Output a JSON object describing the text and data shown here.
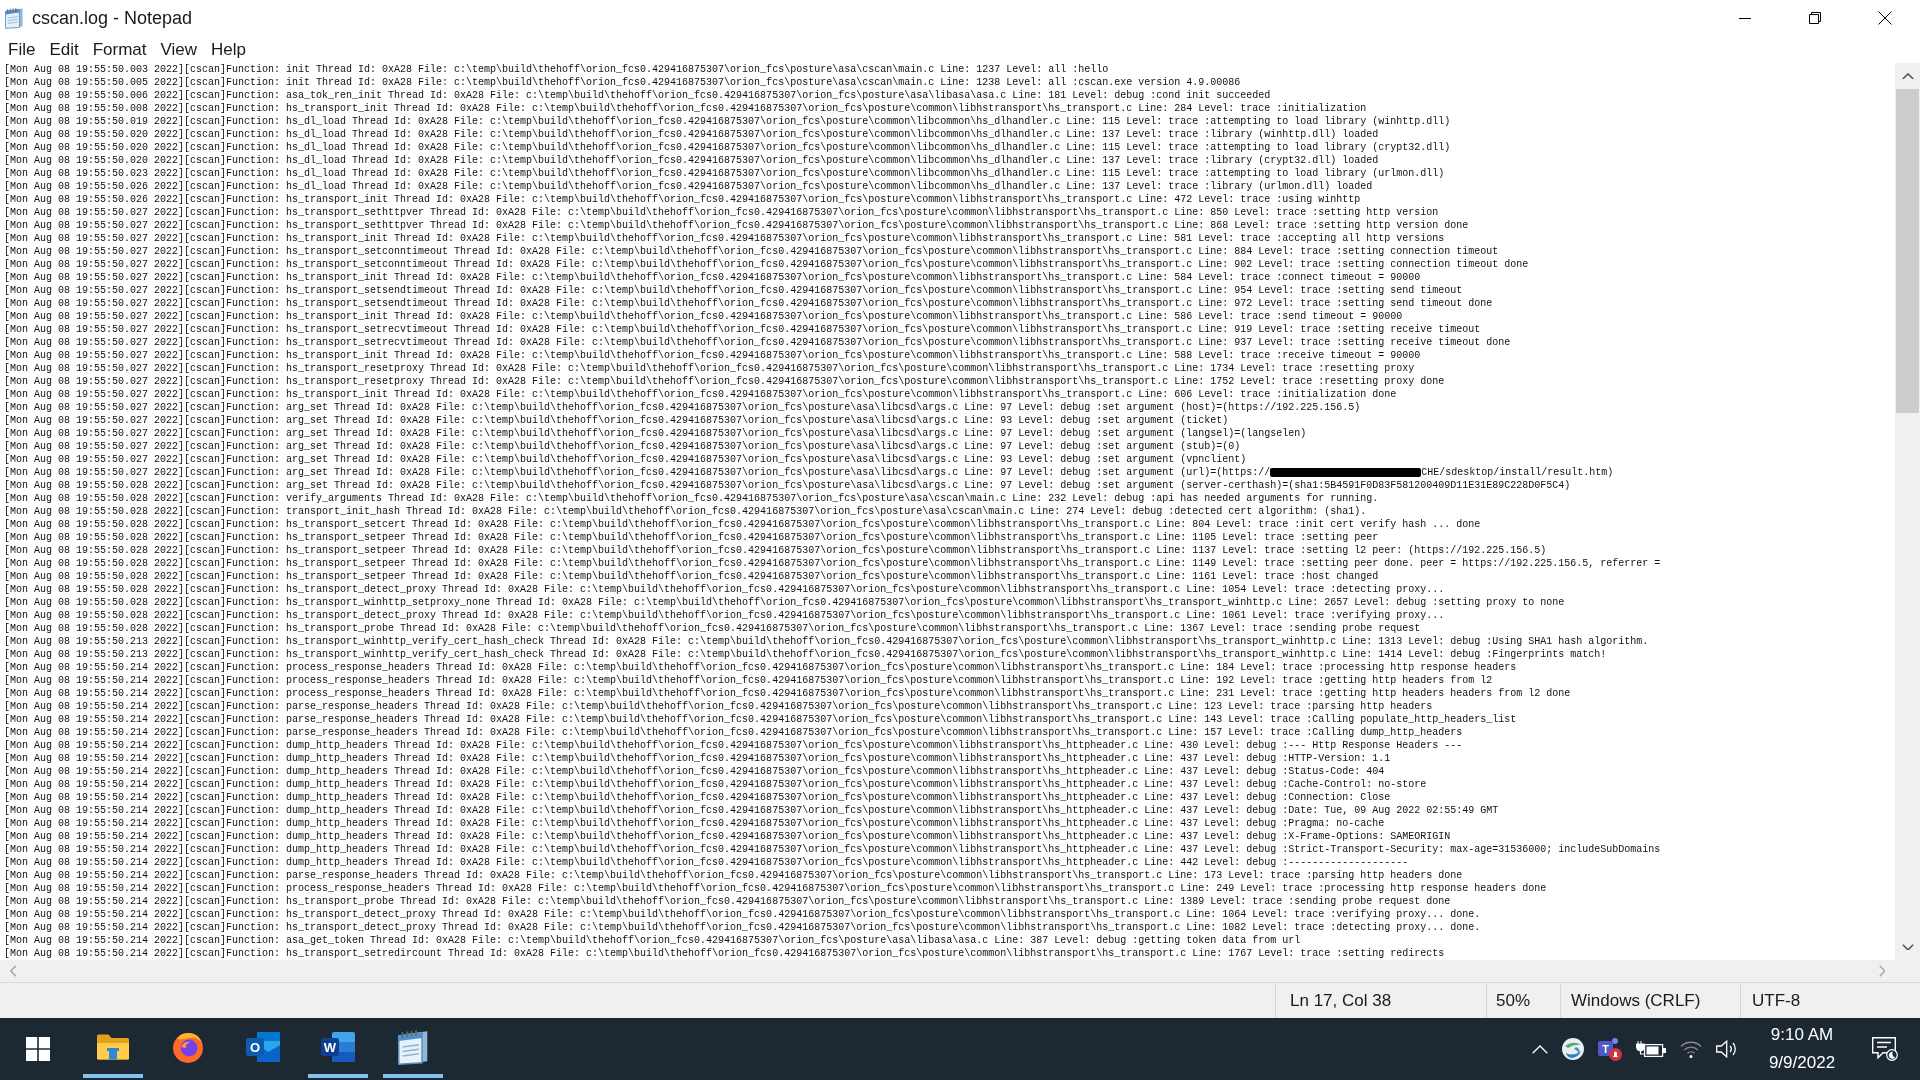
{
  "window": {
    "title": "cscan.log - Notepad"
  },
  "menu": [
    "File",
    "Edit",
    "Format",
    "View",
    "Help"
  ],
  "editor": {
    "lines": [
      {
        "kind": "plain",
        "text": "[Mon Aug 08 19:55:50.003 2022][cscan]Function: init Thread Id: 0xA28 File: c:\\temp\\build\\thehoff\\orion_fcs0.429416875307\\orion_fcs\\posture\\asa\\cscan\\main.c Line: 1237 Level: all :hello"
      },
      {
        "kind": "plain",
        "text": "[Mon Aug 08 19:55:50.005 2022][cscan]Function: init Thread Id: 0xA28 File: c:\\temp\\build\\thehoff\\orion_fcs0.429416875307\\orion_fcs\\posture\\asa\\cscan\\main.c Line: 1238 Level: all :cscan.exe version 4.9.00086"
      },
      {
        "kind": "plain",
        "text": "[Mon Aug 08 19:55:50.006 2022][cscan]Function: asa_tok_ren_init Thread Id: 0xA28 File: c:\\temp\\build\\thehoff\\orion_fcs0.429416875307\\orion_fcs\\posture\\asa\\libasa\\asa.c Line: 181 Level: debug :cond init succeeded"
      },
      {
        "kind": "plain",
        "text": "[Mon Aug 08 19:55:50.008 2022][cscan]Function: hs_transport_init Thread Id: 0xA28 File: c:\\temp\\build\\thehoff\\orion_fcs0.429416875307\\orion_fcs\\posture\\common\\libhstransport\\hs_transport.c Line: 284 Level: trace :initialization"
      },
      {
        "kind": "plain",
        "text": "[Mon Aug 08 19:55:50.019 2022][cscan]Function: hs_dl_load Thread Id: 0xA28 File: c:\\temp\\build\\thehoff\\orion_fcs0.429416875307\\orion_fcs\\posture\\common\\libcommon\\hs_dlhandler.c Line: 115 Level: trace :attempting to load library (winhttp.dll)"
      },
      {
        "kind": "plain",
        "text": "[Mon Aug 08 19:55:50.020 2022][cscan]Function: hs_dl_load Thread Id: 0xA28 File: c:\\temp\\build\\thehoff\\orion_fcs0.429416875307\\orion_fcs\\posture\\common\\libcommon\\hs_dlhandler.c Line: 137 Level: trace :library (winhttp.dll) loaded"
      },
      {
        "kind": "plain",
        "text": "[Mon Aug 08 19:55:50.020 2022][cscan]Function: hs_dl_load Thread Id: 0xA28 File: c:\\temp\\build\\thehoff\\orion_fcs0.429416875307\\orion_fcs\\posture\\common\\libcommon\\hs_dlhandler.c Line: 115 Level: trace :attempting to load library (crypt32.dll)"
      },
      {
        "kind": "plain",
        "text": "[Mon Aug 08 19:55:50.020 2022][cscan]Function: hs_dl_load Thread Id: 0xA28 File: c:\\temp\\build\\thehoff\\orion_fcs0.429416875307\\orion_fcs\\posture\\common\\libcommon\\hs_dlhandler.c Line: 137 Level: trace :library (crypt32.dll) loaded"
      },
      {
        "kind": "plain",
        "text": "[Mon Aug 08 19:55:50.023 2022][cscan]Function: hs_dl_load Thread Id: 0xA28 File: c:\\temp\\build\\thehoff\\orion_fcs0.429416875307\\orion_fcs\\posture\\common\\libcommon\\hs_dlhandler.c Line: 115 Level: trace :attempting to load library (urlmon.dll)"
      },
      {
        "kind": "plain",
        "text": "[Mon Aug 08 19:55:50.026 2022][cscan]Function: hs_dl_load Thread Id: 0xA28 File: c:\\temp\\build\\thehoff\\orion_fcs0.429416875307\\orion_fcs\\posture\\common\\libcommon\\hs_dlhandler.c Line: 137 Level: trace :library (urlmon.dll) loaded"
      },
      {
        "kind": "plain",
        "text": "[Mon Aug 08 19:55:50.026 2022][cscan]Function: hs_transport_init Thread Id: 0xA28 File: c:\\temp\\build\\thehoff\\orion_fcs0.429416875307\\orion_fcs\\posture\\common\\libhstransport\\hs_transport.c Line: 472 Level: trace :using winhttp"
      },
      {
        "kind": "plain",
        "text": "[Mon Aug 08 19:55:50.027 2022][cscan]Function: hs_transport_sethttpver Thread Id: 0xA28 File: c:\\temp\\build\\thehoff\\orion_fcs0.429416875307\\orion_fcs\\posture\\common\\libhstransport\\hs_transport.c Line: 850 Level: trace :setting http version"
      },
      {
        "kind": "plain",
        "text": "[Mon Aug 08 19:55:50.027 2022][cscan]Function: hs_transport_sethttpver Thread Id: 0xA28 File: c:\\temp\\build\\thehoff\\orion_fcs0.429416875307\\orion_fcs\\posture\\common\\libhstransport\\hs_transport.c Line: 868 Level: trace :setting http version done"
      },
      {
        "kind": "plain",
        "text": "[Mon Aug 08 19:55:50.027 2022][cscan]Function: hs_transport_init Thread Id: 0xA28 File: c:\\temp\\build\\thehoff\\orion_fcs0.429416875307\\orion_fcs\\posture\\common\\libhstransport\\hs_transport.c Line: 581 Level: trace :accepting all http versions"
      },
      {
        "kind": "plain",
        "text": "[Mon Aug 08 19:55:50.027 2022][cscan]Function: hs_transport_setconntimeout Thread Id: 0xA28 File: c:\\temp\\build\\thehoff\\orion_fcs0.429416875307\\orion_fcs\\posture\\common\\libhstransport\\hs_transport.c Line: 884 Level: trace :setting connection timeout"
      },
      {
        "kind": "plain",
        "text": "[Mon Aug 08 19:55:50.027 2022][cscan]Function: hs_transport_setconntimeout Thread Id: 0xA28 File: c:\\temp\\build\\thehoff\\orion_fcs0.429416875307\\orion_fcs\\posture\\common\\libhstransport\\hs_transport.c Line: 902 Level: trace :setting connection timeout done"
      },
      {
        "kind": "plain",
        "text": "[Mon Aug 08 19:55:50.027 2022][cscan]Function: hs_transport_init Thread Id: 0xA28 File: c:\\temp\\build\\thehoff\\orion_fcs0.429416875307\\orion_fcs\\posture\\common\\libhstransport\\hs_transport.c Line: 584 Level: trace :connect timeout = 90000"
      },
      {
        "kind": "plain",
        "text": "[Mon Aug 08 19:55:50.027 2022][cscan]Function: hs_transport_setsendtimeout Thread Id: 0xA28 File: c:\\temp\\build\\thehoff\\orion_fcs0.429416875307\\orion_fcs\\posture\\common\\libhstransport\\hs_transport.c Line: 954 Level: trace :setting send timeout"
      },
      {
        "kind": "plain",
        "text": "[Mon Aug 08 19:55:50.027 2022][cscan]Function: hs_transport_setsendtimeout Thread Id: 0xA28 File: c:\\temp\\build\\thehoff\\orion_fcs0.429416875307\\orion_fcs\\posture\\common\\libhstransport\\hs_transport.c Line: 972 Level: trace :setting send timeout done"
      },
      {
        "kind": "plain",
        "text": "[Mon Aug 08 19:55:50.027 2022][cscan]Function: hs_transport_init Thread Id: 0xA28 File: c:\\temp\\build\\thehoff\\orion_fcs0.429416875307\\orion_fcs\\posture\\common\\libhstransport\\hs_transport.c Line: 586 Level: trace :send timeout = 90000"
      },
      {
        "kind": "plain",
        "text": "[Mon Aug 08 19:55:50.027 2022][cscan]Function: hs_transport_setrecvtimeout Thread Id: 0xA28 File: c:\\temp\\build\\thehoff\\orion_fcs0.429416875307\\orion_fcs\\posture\\common\\libhstransport\\hs_transport.c Line: 919 Level: trace :setting receive timeout"
      },
      {
        "kind": "plain",
        "text": "[Mon Aug 08 19:55:50.027 2022][cscan]Function: hs_transport_setrecvtimeout Thread Id: 0xA28 File: c:\\temp\\build\\thehoff\\orion_fcs0.429416875307\\orion_fcs\\posture\\common\\libhstransport\\hs_transport.c Line: 937 Level: trace :setting receive timeout done"
      },
      {
        "kind": "plain",
        "text": "[Mon Aug 08 19:55:50.027 2022][cscan]Function: hs_transport_init Thread Id: 0xA28 File: c:\\temp\\build\\thehoff\\orion_fcs0.429416875307\\orion_fcs\\posture\\common\\libhstransport\\hs_transport.c Line: 588 Level: trace :receive timeout = 90000"
      },
      {
        "kind": "plain",
        "text": "[Mon Aug 08 19:55:50.027 2022][cscan]Function: hs_transport_resetproxy Thread Id: 0xA28 File: c:\\temp\\build\\thehoff\\orion_fcs0.429416875307\\orion_fcs\\posture\\common\\libhstransport\\hs_transport.c Line: 1734 Level: trace :resetting proxy"
      },
      {
        "kind": "plain",
        "text": "[Mon Aug 08 19:55:50.027 2022][cscan]Function: hs_transport_resetproxy Thread Id: 0xA28 File: c:\\temp\\build\\thehoff\\orion_fcs0.429416875307\\orion_fcs\\posture\\common\\libhstransport\\hs_transport.c Line: 1752 Level: trace :resetting proxy done"
      },
      {
        "kind": "plain",
        "text": "[Mon Aug 08 19:55:50.027 2022][cscan]Function: hs_transport_init Thread Id: 0xA28 File: c:\\temp\\build\\thehoff\\orion_fcs0.429416875307\\orion_fcs\\posture\\common\\libhstransport\\hs_transport.c Line: 606 Level: trace :initialization done"
      },
      {
        "kind": "plain",
        "text": "[Mon Aug 08 19:55:50.027 2022][cscan]Function: arg_set Thread Id: 0xA28 File: c:\\temp\\build\\thehoff\\orion_fcs0.429416875307\\orion_fcs\\posture\\asa\\libcsd\\args.c Line: 97 Level: debug :set argument (host)=(https://192.225.156.5)"
      },
      {
        "kind": "plain",
        "text": "[Mon Aug 08 19:55:50.027 2022][cscan]Function: arg_set Thread Id: 0xA28 File: c:\\temp\\build\\thehoff\\orion_fcs0.429416875307\\orion_fcs\\posture\\asa\\libcsd\\args.c Line: 93 Level: debug :set argument (ticket)"
      },
      {
        "kind": "plain",
        "text": "[Mon Aug 08 19:55:50.027 2022][cscan]Function: arg_set Thread Id: 0xA28 File: c:\\temp\\build\\thehoff\\orion_fcs0.429416875307\\orion_fcs\\posture\\asa\\libcsd\\args.c Line: 97 Level: debug :set argument (langsel)=(langselen)"
      },
      {
        "kind": "plain",
        "text": "[Mon Aug 08 19:55:50.027 2022][cscan]Function: arg_set Thread Id: 0xA28 File: c:\\temp\\build\\thehoff\\orion_fcs0.429416875307\\orion_fcs\\posture\\asa\\libcsd\\args.c Line: 97 Level: debug :set argument (stub)=(0)"
      },
      {
        "kind": "plain",
        "text": "[Mon Aug 08 19:55:50.027 2022][cscan]Function: arg_set Thread Id: 0xA28 File: c:\\temp\\build\\thehoff\\orion_fcs0.429416875307\\orion_fcs\\posture\\asa\\libcsd\\args.c Line: 93 Level: debug :set argument (vpnclient)"
      },
      {
        "kind": "redacted",
        "before": "[Mon Aug 08 19:55:50.027 2022][cscan]Function: arg_set Thread Id: 0xA28 File: c:\\temp\\build\\thehoff\\orion_fcs0.429416875307\\orion_fcs\\posture\\asa\\libcsd\\args.c Line: 97 Level: debug :set argument (url)=(https://",
        "after": "CHE/sdesktop/install/result.htm)"
      },
      {
        "kind": "plain",
        "text": "[Mon Aug 08 19:55:50.028 2022][cscan]Function: arg_set Thread Id: 0xA28 File: c:\\temp\\build\\thehoff\\orion_fcs0.429416875307\\orion_fcs\\posture\\asa\\libcsd\\args.c Line: 97 Level: debug :set argument (server-certhash)=(sha1:5B4591F0D83F581200409D11E31E89C228D0F5C4)"
      },
      {
        "kind": "plain",
        "text": "[Mon Aug 08 19:55:50.028 2022][cscan]Function: verify_arguments Thread Id: 0xA28 File: c:\\temp\\build\\thehoff\\orion_fcs0.429416875307\\orion_fcs\\posture\\asa\\cscan\\main.c Line: 232 Level: debug :api has needed arguments for running."
      },
      {
        "kind": "plain",
        "text": "[Mon Aug 08 19:55:50.028 2022][cscan]Function: transport_init_hash Thread Id: 0xA28 File: c:\\temp\\build\\thehoff\\orion_fcs0.429416875307\\orion_fcs\\posture\\asa\\cscan\\main.c Line: 274 Level: debug :detected cert algorithm: (sha1)."
      },
      {
        "kind": "plain",
        "text": "[Mon Aug 08 19:55:50.028 2022][cscan]Function: hs_transport_setcert Thread Id: 0xA28 File: c:\\temp\\build\\thehoff\\orion_fcs0.429416875307\\orion_fcs\\posture\\common\\libhstransport\\hs_transport.c Line: 804 Level: trace :init cert verify hash ... done"
      },
      {
        "kind": "plain",
        "text": "[Mon Aug 08 19:55:50.028 2022][cscan]Function: hs_transport_setpeer Thread Id: 0xA28 File: c:\\temp\\build\\thehoff\\orion_fcs0.429416875307\\orion_fcs\\posture\\common\\libhstransport\\hs_transport.c Line: 1105 Level: trace :setting peer"
      },
      {
        "kind": "plain",
        "text": "[Mon Aug 08 19:55:50.028 2022][cscan]Function: hs_transport_setpeer Thread Id: 0xA28 File: c:\\temp\\build\\thehoff\\orion_fcs0.429416875307\\orion_fcs\\posture\\common\\libhstransport\\hs_transport.c Line: 1137 Level: trace :setting l2 peer: (https://192.225.156.5)"
      },
      {
        "kind": "plain",
        "text": "[Mon Aug 08 19:55:50.028 2022][cscan]Function: hs_transport_setpeer Thread Id: 0xA28 File: c:\\temp\\build\\thehoff\\orion_fcs0.429416875307\\orion_fcs\\posture\\common\\libhstransport\\hs_transport.c Line: 1149 Level: trace :setting peer done. peer = https://192.225.156.5, referrer ="
      },
      {
        "kind": "plain",
        "text": "[Mon Aug 08 19:55:50.028 2022][cscan]Function: hs_transport_setpeer Thread Id: 0xA28 File: c:\\temp\\build\\thehoff\\orion_fcs0.429416875307\\orion_fcs\\posture\\common\\libhstransport\\hs_transport.c Line: 1161 Level: trace :host changed"
      },
      {
        "kind": "plain",
        "text": "[Mon Aug 08 19:55:50.028 2022][cscan]Function: hs_transport_detect_proxy Thread Id: 0xA28 File: c:\\temp\\build\\thehoff\\orion_fcs0.429416875307\\orion_fcs\\posture\\common\\libhstransport\\hs_transport.c Line: 1054 Level: trace :detecting proxy..."
      },
      {
        "kind": "plain",
        "text": "[Mon Aug 08 19:55:50.028 2022][cscan]Function: hs_transport_winhttp_setproxy_none Thread Id: 0xA28 File: c:\\temp\\build\\thehoff\\orion_fcs0.429416875307\\orion_fcs\\posture\\common\\libhstransport\\hs_transport_winhttp.c Line: 2657 Level: debug :setting proxy to none"
      },
      {
        "kind": "plain",
        "text": "[Mon Aug 08 19:55:50.028 2022][cscan]Function: hs_transport_detect_proxy Thread Id: 0xA28 File: c:\\temp\\build\\thehoff\\orion_fcs0.429416875307\\orion_fcs\\posture\\common\\libhstransport\\hs_transport.c Line: 1061 Level: trace :verifying proxy..."
      },
      {
        "kind": "plain",
        "text": "[Mon Aug 08 19:55:50.028 2022][cscan]Function: hs_transport_probe Thread Id: 0xA28 File: c:\\temp\\build\\thehoff\\orion_fcs0.429416875307\\orion_fcs\\posture\\common\\libhstransport\\hs_transport.c Line: 1367 Level: trace :sending probe request"
      },
      {
        "kind": "plain",
        "text": "[Mon Aug 08 19:55:50.213 2022][cscan]Function: hs_transport_winhttp_verify_cert_hash_check Thread Id: 0xA28 File: c:\\temp\\build\\thehoff\\orion_fcs0.429416875307\\orion_fcs\\posture\\common\\libhstransport\\hs_transport_winhttp.c Line: 1313 Level: debug :Using SHA1 hash algorithm."
      },
      {
        "kind": "plain",
        "text": "[Mon Aug 08 19:55:50.213 2022][cscan]Function: hs_transport_winhttp_verify_cert_hash_check Thread Id: 0xA28 File: c:\\temp\\build\\thehoff\\orion_fcs0.429416875307\\orion_fcs\\posture\\common\\libhstransport\\hs_transport_winhttp.c Line: 1414 Level: debug :Fingerprints match!"
      },
      {
        "kind": "plain",
        "text": "[Mon Aug 08 19:55:50.214 2022][cscan]Function: process_response_headers Thread Id: 0xA28 File: c:\\temp\\build\\thehoff\\orion_fcs0.429416875307\\orion_fcs\\posture\\common\\libhstransport\\hs_transport.c Line: 184 Level: trace :processing http response headers"
      },
      {
        "kind": "plain",
        "text": "[Mon Aug 08 19:55:50.214 2022][cscan]Function: process_response_headers Thread Id: 0xA28 File: c:\\temp\\build\\thehoff\\orion_fcs0.429416875307\\orion_fcs\\posture\\common\\libhstransport\\hs_transport.c Line: 192 Level: trace :getting http headers from l2"
      },
      {
        "kind": "plain",
        "text": "[Mon Aug 08 19:55:50.214 2022][cscan]Function: process_response_headers Thread Id: 0xA28 File: c:\\temp\\build\\thehoff\\orion_fcs0.429416875307\\orion_fcs\\posture\\common\\libhstransport\\hs_transport.c Line: 231 Level: trace :getting http headers headers from l2 done"
      },
      {
        "kind": "plain",
        "text": "[Mon Aug 08 19:55:50.214 2022][cscan]Function: parse_response_headers Thread Id: 0xA28 File: c:\\temp\\build\\thehoff\\orion_fcs0.429416875307\\orion_fcs\\posture\\common\\libhstransport\\hs_transport.c Line: 123 Level: trace :parsing http headers"
      },
      {
        "kind": "plain",
        "text": "[Mon Aug 08 19:55:50.214 2022][cscan]Function: parse_response_headers Thread Id: 0xA28 File: c:\\temp\\build\\thehoff\\orion_fcs0.429416875307\\orion_fcs\\posture\\common\\libhstransport\\hs_transport.c Line: 143 Level: trace :Calling populate_http_headers_list"
      },
      {
        "kind": "plain",
        "text": "[Mon Aug 08 19:55:50.214 2022][cscan]Function: parse_response_headers Thread Id: 0xA28 File: c:\\temp\\build\\thehoff\\orion_fcs0.429416875307\\orion_fcs\\posture\\common\\libhstransport\\hs_transport.c Line: 157 Level: trace :Calling dump_http_headers"
      },
      {
        "kind": "plain",
        "text": "[Mon Aug 08 19:55:50.214 2022][cscan]Function: dump_http_headers Thread Id: 0xA28 File: c:\\temp\\build\\thehoff\\orion_fcs0.429416875307\\orion_fcs\\posture\\common\\libhstransport\\hs_httpheader.c Line: 430 Level: debug :--- Http Response Headers ---"
      },
      {
        "kind": "plain",
        "text": "[Mon Aug 08 19:55:50.214 2022][cscan]Function: dump_http_headers Thread Id: 0xA28 File: c:\\temp\\build\\thehoff\\orion_fcs0.429416875307\\orion_fcs\\posture\\common\\libhstransport\\hs_httpheader.c Line: 437 Level: debug :HTTP-Version: 1.1"
      },
      {
        "kind": "plain",
        "text": "[Mon Aug 08 19:55:50.214 2022][cscan]Function: dump_http_headers Thread Id: 0xA28 File: c:\\temp\\build\\thehoff\\orion_fcs0.429416875307\\orion_fcs\\posture\\common\\libhstransport\\hs_httpheader.c Line: 437 Level: debug :Status-Code: 404"
      },
      {
        "kind": "plain",
        "text": "[Mon Aug 08 19:55:50.214 2022][cscan]Function: dump_http_headers Thread Id: 0xA28 File: c:\\temp\\build\\thehoff\\orion_fcs0.429416875307\\orion_fcs\\posture\\common\\libhstransport\\hs_httpheader.c Line: 437 Level: debug :Cache-Control: no-store"
      },
      {
        "kind": "plain",
        "text": "[Mon Aug 08 19:55:50.214 2022][cscan]Function: dump_http_headers Thread Id: 0xA28 File: c:\\temp\\build\\thehoff\\orion_fcs0.429416875307\\orion_fcs\\posture\\common\\libhstransport\\hs_httpheader.c Line: 437 Level: debug :Connection: Close"
      },
      {
        "kind": "plain",
        "text": "[Mon Aug 08 19:55:50.214 2022][cscan]Function: dump_http_headers Thread Id: 0xA28 File: c:\\temp\\build\\thehoff\\orion_fcs0.429416875307\\orion_fcs\\posture\\common\\libhstransport\\hs_httpheader.c Line: 437 Level: debug :Date: Tue, 09 Aug 2022 02:55:49 GMT"
      },
      {
        "kind": "plain",
        "text": "[Mon Aug 08 19:55:50.214 2022][cscan]Function: dump_http_headers Thread Id: 0xA28 File: c:\\temp\\build\\thehoff\\orion_fcs0.429416875307\\orion_fcs\\posture\\common\\libhstransport\\hs_httpheader.c Line: 437 Level: debug :Pragma: no-cache"
      },
      {
        "kind": "plain",
        "text": "[Mon Aug 08 19:55:50.214 2022][cscan]Function: dump_http_headers Thread Id: 0xA28 File: c:\\temp\\build\\thehoff\\orion_fcs0.429416875307\\orion_fcs\\posture\\common\\libhstransport\\hs_httpheader.c Line: 437 Level: debug :X-Frame-Options: SAMEORIGIN"
      },
      {
        "kind": "plain",
        "text": "[Mon Aug 08 19:55:50.214 2022][cscan]Function: dump_http_headers Thread Id: 0xA28 File: c:\\temp\\build\\thehoff\\orion_fcs0.429416875307\\orion_fcs\\posture\\common\\libhstransport\\hs_httpheader.c Line: 437 Level: debug :Strict-Transport-Security: max-age=31536000; includeSubDomains"
      },
      {
        "kind": "plain",
        "text": "[Mon Aug 08 19:55:50.214 2022][cscan]Function: dump_http_headers Thread Id: 0xA28 File: c:\\temp\\build\\thehoff\\orion_fcs0.429416875307\\orion_fcs\\posture\\common\\libhstransport\\hs_httpheader.c Line: 442 Level: debug :--------------------"
      },
      {
        "kind": "plain",
        "text": "[Mon Aug 08 19:55:50.214 2022][cscan]Function: parse_response_headers Thread Id: 0xA28 File: c:\\temp\\build\\thehoff\\orion_fcs0.429416875307\\orion_fcs\\posture\\common\\libhstransport\\hs_transport.c Line: 173 Level: trace :parsing http headers done"
      },
      {
        "kind": "plain",
        "text": "[Mon Aug 08 19:55:50.214 2022][cscan]Function: process_response_headers Thread Id: 0xA28 File: c:\\temp\\build\\thehoff\\orion_fcs0.429416875307\\orion_fcs\\posture\\common\\libhstransport\\hs_transport.c Line: 249 Level: trace :processing http response headers done"
      },
      {
        "kind": "plain",
        "text": "[Mon Aug 08 19:55:50.214 2022][cscan]Function: hs_transport_probe Thread Id: 0xA28 File: c:\\temp\\build\\thehoff\\orion_fcs0.429416875307\\orion_fcs\\posture\\common\\libhstransport\\hs_transport.c Line: 1389 Level: trace :sending probe request done"
      },
      {
        "kind": "plain",
        "text": "[Mon Aug 08 19:55:50.214 2022][cscan]Function: hs_transport_detect_proxy Thread Id: 0xA28 File: c:\\temp\\build\\thehoff\\orion_fcs0.429416875307\\orion_fcs\\posture\\common\\libhstransport\\hs_transport.c Line: 1064 Level: trace :verifying proxy... done."
      },
      {
        "kind": "plain",
        "text": "[Mon Aug 08 19:55:50.214 2022][cscan]Function: hs_transport_detect_proxy Thread Id: 0xA28 File: c:\\temp\\build\\thehoff\\orion_fcs0.429416875307\\orion_fcs\\posture\\common\\libhstransport\\hs_transport.c Line: 1082 Level: trace :detecting proxy... done."
      },
      {
        "kind": "plain",
        "text": "[Mon Aug 08 19:55:50.214 2022][cscan]Function: asa_get_token Thread Id: 0xA28 File: c:\\temp\\build\\thehoff\\orion_fcs0.429416875307\\orion_fcs\\posture\\asa\\libasa\\asa.c Line: 387 Level: debug :getting token data from url"
      },
      {
        "kind": "plain",
        "text": "[Mon Aug 08 19:55:50.214 2022][cscan]Function: hs_transport_setredircount Thread Id: 0xA28 File: c:\\temp\\build\\thehoff\\orion_fcs0.429416875307\\orion_fcs\\posture\\common\\libhstransport\\hs_transport.c Line: 1767 Level: trace :setting redirects"
      }
    ]
  },
  "status_bar": {
    "position": "Ln 17, Col 38",
    "zoom": "50%",
    "line_ending": "Windows (CRLF)",
    "encoding": "UTF-8"
  },
  "taskbar": {
    "apps": [
      {
        "kind": "explorer",
        "running": true
      },
      {
        "kind": "firefox",
        "running": false
      },
      {
        "kind": "outlook",
        "glyph": "O",
        "running": false
      },
      {
        "kind": "word",
        "glyph": "W",
        "running": true
      },
      {
        "kind": "notepad",
        "running": true
      }
    ],
    "tray_chat": {
      "glyph": "T"
    },
    "clock": {
      "time": "9:10 AM",
      "date": "9/9/2022"
    }
  }
}
